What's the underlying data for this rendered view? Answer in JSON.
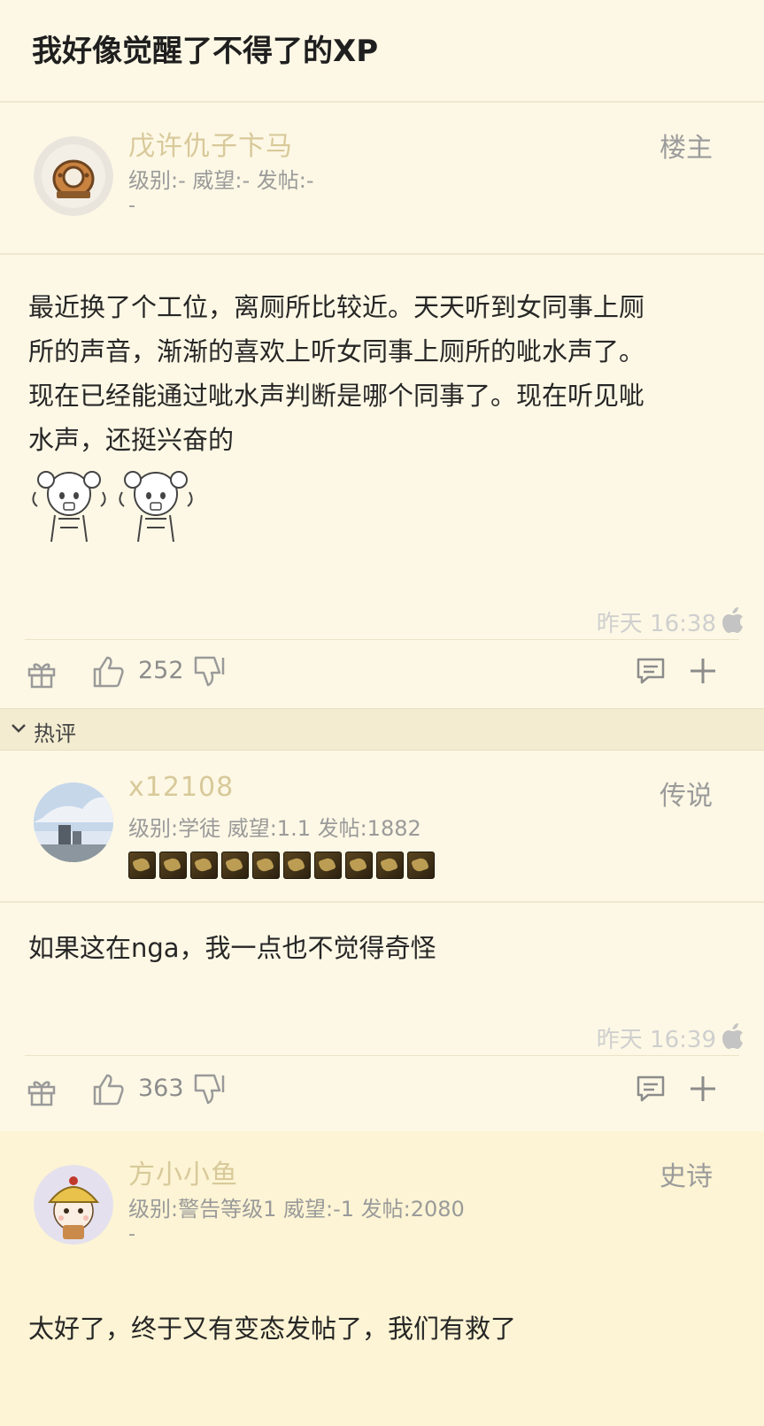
{
  "thread": {
    "title": "我好像觉醒了不得了的XP"
  },
  "posts": [
    {
      "username": "戊许仇子卞马",
      "meta": "级别:- 威望:- 发帖:-",
      "meta_extra": "-",
      "role": "楼主",
      "content": [
        "最近换了个工位，离厕所比较近。天天听到女同事上厕",
        "所的声音，渐渐的喜欢上听女同事上厕所的呲水声了。",
        "现在已经能通过呲水声判断是哪个同事了。现在听见呲",
        "水声，还挺兴奋的"
      ],
      "time": "昨天 16:38",
      "likes": "252"
    },
    {
      "username": "x12108",
      "meta": "级别:学徒 威望:1.1 发帖:1882",
      "role": "传说",
      "content": [
        "如果这在nga，我一点也不觉得奇怪"
      ],
      "time": "昨天 16:39",
      "likes": "363"
    },
    {
      "username": "方小小鱼",
      "meta": "级别:警告等级1 威望:-1 发帖:2080",
      "meta_extra": "-",
      "role": "史诗",
      "content": [
        "太好了，终于又有变态发帖了，我们有救了"
      ]
    }
  ],
  "hot_section": {
    "label": "热评"
  },
  "icons": {
    "gift": "gift-icon",
    "like": "thumbs-up-icon",
    "dislike": "thumbs-down-icon",
    "comment": "comment-icon",
    "plus": "plus-icon",
    "platform": "apple-icon",
    "chevron": "chevron-down-icon"
  },
  "colors": {
    "background": "#fdf8e5",
    "highlight_background": "#fcf4d4",
    "username": "#d8c99a",
    "muted": "#9a9a9a"
  }
}
